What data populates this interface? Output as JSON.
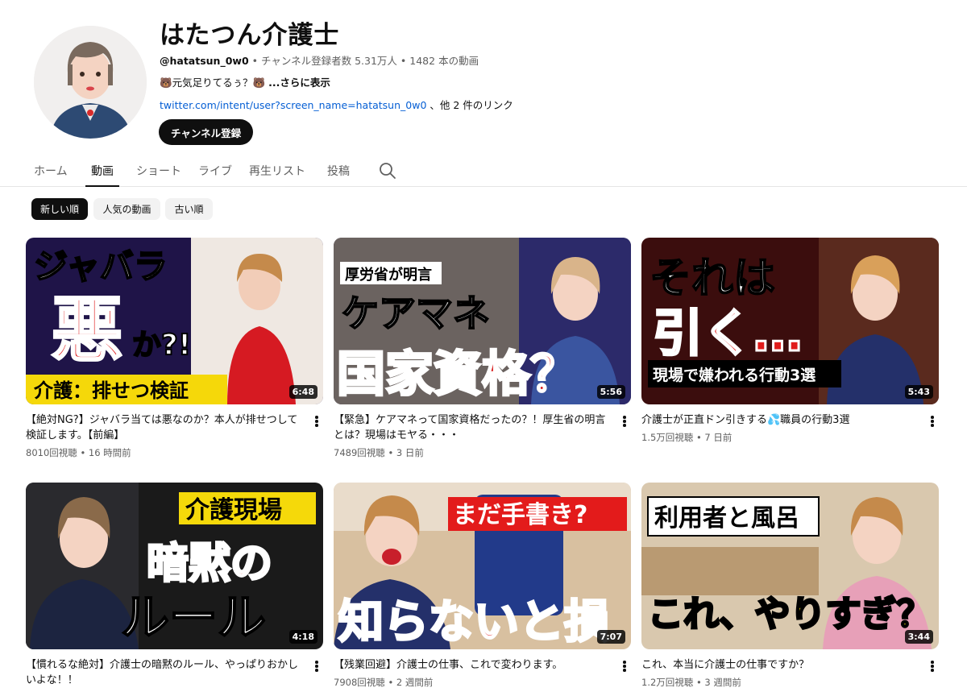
{
  "channel": {
    "name": "はたつん介護士",
    "handle": "@hatatsun_0w0",
    "subscribers": "チャンネル登録者数 5.31万人",
    "video_count": "1482 本の動画",
    "separator": "•",
    "description": "🐻元気足りてるぅ？🐻 ",
    "description_more": "...さらに表示",
    "link_url": "twitter.com/intent/user?screen_name=hatatsun_0w0",
    "link_suffix": " 、他 2 件のリンク",
    "subscribe_label": "チャンネル登録"
  },
  "tabs": [
    {
      "label": "ホーム"
    },
    {
      "label": "動画"
    },
    {
      "label": "ショート"
    },
    {
      "label": "ライブ"
    },
    {
      "label": "再生リスト"
    },
    {
      "label": "投稿"
    }
  ],
  "active_tab": "動画",
  "sort_chips": [
    {
      "label": "新しい順"
    },
    {
      "label": "人気の動画"
    },
    {
      "label": "古い順"
    }
  ],
  "active_chip": "新しい順",
  "videos": [
    {
      "title": "【絶対NG?】ジャバラ当ては悪なのか？本人が排せつして検証します。【前編】",
      "views": "8010回視聴",
      "age": "16 時間前",
      "duration": "6:48",
      "thumb_text": [
        "ジャバラ",
        "悪",
        "か?!",
        "介護：排せつ検証"
      ],
      "thumb_colors": [
        "#2a1a5e",
        "#e02020"
      ]
    },
    {
      "title": "【緊急】ケアマネって国家資格だったの？！厚生省の明言とは？現場はモヤる・・・",
      "views": "7489回視聴",
      "age": "3 日前",
      "duration": "5:56",
      "thumb_text": [
        "厚労省が明言",
        "ケアマネ",
        "国家資格？"
      ],
      "thumb_colors": [
        "#3a3550",
        "#d81b1b"
      ]
    },
    {
      "title": "介護士が正直ドン引きする💦職員の行動3選",
      "views": "1.5万回視聴",
      "age": "7 日前",
      "duration": "5:43",
      "thumb_text": [
        "それは",
        "引く…",
        "現場で嫌われる行動3選"
      ],
      "thumb_colors": [
        "#3b0d0d",
        "#e01b1b"
      ]
    },
    {
      "title": "【慣れるな絶対】介護士の暗黙のルール、やっぱりおかしいよな！！",
      "views": "",
      "age": "",
      "duration": "4:18",
      "thumb_text": [
        "介護現場",
        "暗黙の",
        "ルール"
      ],
      "thumb_colors": [
        "#1a1a1a",
        "#f5d90a"
      ]
    },
    {
      "title": "【残業回避】介護士の仕事、これで変わります。",
      "views": "7908回視聴",
      "age": "2 週間前",
      "duration": "7:07",
      "thumb_text": [
        "まだ手書き?",
        "知らないと損"
      ],
      "thumb_colors": [
        "#c9a27a",
        "#e31b1b"
      ]
    },
    {
      "title": "これ、本当に介護士の仕事ですか？",
      "views": "1.2万回視聴",
      "age": "3 週間前",
      "duration": "3:44",
      "thumb_text": [
        "利用者と風呂",
        "これ、やりすぎ？"
      ],
      "thumb_colors": [
        "#d8c4a8",
        "#f5e60a"
      ]
    }
  ],
  "colors": {
    "link": "#065fd4",
    "text": "#0f0f0f",
    "secondary": "#606060"
  }
}
